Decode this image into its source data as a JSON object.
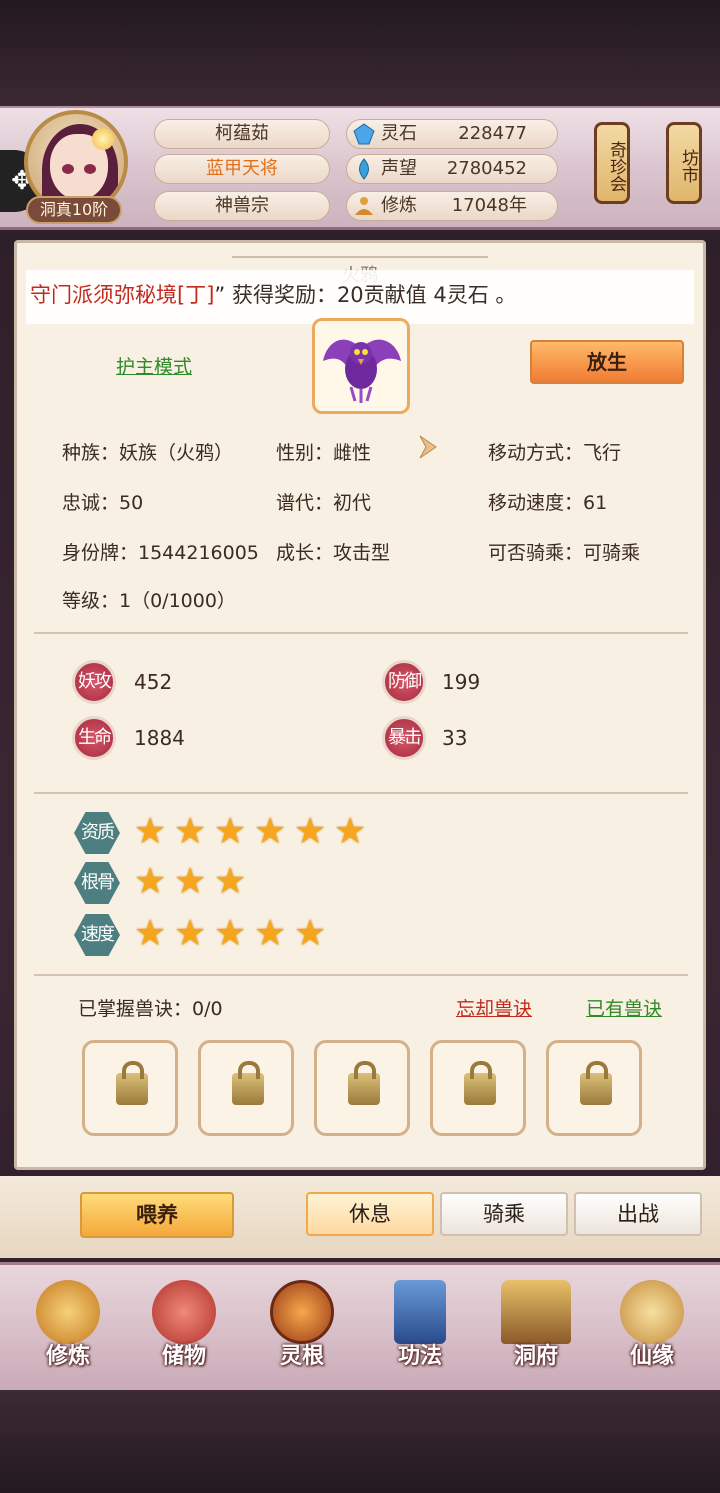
{
  "header": {
    "player_name": "柯蕴茹",
    "title": "蓝甲天将",
    "sect": "神兽宗",
    "rank": "洞真10阶",
    "resources": [
      {
        "label": "灵石",
        "value": "228477",
        "icon": "spirit-stone-icon"
      },
      {
        "label": "声望",
        "value": "2780452",
        "icon": "reputation-icon"
      },
      {
        "label": "修炼",
        "value": "17048年",
        "icon": "cultivation-icon"
      }
    ],
    "lanterns": [
      {
        "label": "奇珍会"
      },
      {
        "label": "坊市"
      }
    ]
  },
  "panel": {
    "title": "火鸦",
    "marquee_prefix": "守门派须弥秘境[丁]",
    "marquee_suffix": "” 获得奖励：20贡献值 4灵石 。",
    "guard_mode": "护主模式",
    "release_button": "放生",
    "attributes": {
      "race": "种族：妖族（火鸦）",
      "gender": "性别：雌性",
      "move_mode": "移动方式：飞行",
      "loyalty": "忠诚：50",
      "lineage": "谱代：初代",
      "move_speed": "移动速度：61",
      "id_tag": "身份牌：1544216005",
      "growth": "成长：攻击型",
      "rideable": "可否骑乘：可骑乘",
      "level": "等级：1（0/1000）"
    },
    "stats": [
      {
        "label": "妖攻",
        "value": "452"
      },
      {
        "label": "防御",
        "value": "199"
      },
      {
        "label": "生命",
        "value": "1884"
      },
      {
        "label": "暴击",
        "value": "33"
      }
    ],
    "aptitudes": [
      {
        "label": "资质",
        "stars": 6
      },
      {
        "label": "根骨",
        "stars": 3
      },
      {
        "label": "速度",
        "stars": 5
      }
    ],
    "skills_label": "已掌握兽诀：0/0",
    "forget_link": "忘却兽诀",
    "owned_link": "已有兽诀",
    "skill_slots": 5
  },
  "actions": {
    "feed": "喂养",
    "tabs": [
      "休息",
      "骑乘",
      "出战"
    ],
    "active_tab": "休息"
  },
  "nav": [
    {
      "label": "修炼",
      "icon": "cultivate-icon",
      "color": "#e5a23a"
    },
    {
      "label": "储物",
      "icon": "storage-bag-icon",
      "color": "#d0423a"
    },
    {
      "label": "灵根",
      "icon": "spirit-root-icon",
      "color": "#d8632a"
    },
    {
      "label": "功法",
      "icon": "technique-book-icon",
      "color": "#3a6ab0"
    },
    {
      "label": "洞府",
      "icon": "cave-dwelling-icon",
      "color": "#b88a3a"
    },
    {
      "label": "仙缘",
      "icon": "destiny-gourd-icon",
      "color": "#c4553a"
    }
  ]
}
